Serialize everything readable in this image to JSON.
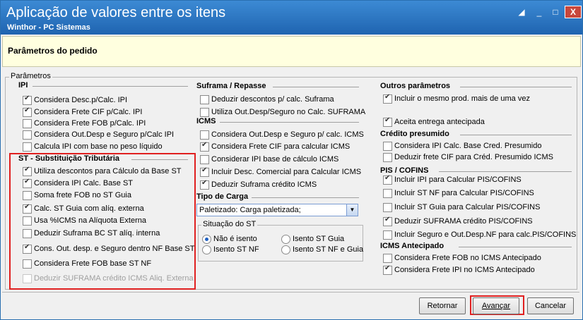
{
  "window": {
    "title": "Aplicação de valores entre os itens",
    "subtitle": "Winthor - PC Sistemas",
    "controls": [
      "◢",
      "_",
      "□",
      "X"
    ]
  },
  "header": {
    "label": "Parâmetros do pedido"
  },
  "params_legend": "Parâmetros",
  "ipi": {
    "title": "IPI",
    "items": [
      {
        "label": "Considera Desc.p/Calc. IPI",
        "checked": true
      },
      {
        "label": "Considera Frete CIF p/Calc. IPI",
        "checked": true
      },
      {
        "label": "Considera Frete FOB p/Calc. IPI",
        "checked": false
      },
      {
        "label": "Considera Out.Desp e Seguro p/Calc IPI",
        "checked": false
      },
      {
        "label": "Calcula IPI com base no peso líquido",
        "checked": false
      }
    ]
  },
  "st": {
    "title": "ST - Substituição Tributária",
    "items": [
      {
        "label": "Utiliza descontos para Cálculo da Base ST",
        "checked": true
      },
      {
        "label": "Considera IPI Calc. Base ST",
        "checked": true
      },
      {
        "label": "Soma frete FOB no ST Guia",
        "checked": false
      },
      {
        "label": "Calc. ST Guia com alíq. externa",
        "checked": true
      },
      {
        "label": "Usa %ICMS na Alíquota Externa",
        "checked": false
      },
      {
        "label": "Deduzir Suframa BC ST alíq. interna",
        "checked": false
      },
      {
        "label": "Cons. Out. desp. e Seguro dentro NF Base ST",
        "checked": true
      },
      {
        "label": "Considera Frete FOB base ST NF",
        "checked": false
      },
      {
        "label": "Deduzir SUFRAMA crédito ICMS Aliq. Externa",
        "checked": false
      }
    ]
  },
  "suframa": {
    "title": "Suframa / Repasse",
    "items": [
      {
        "label": "Deduzir descontos p/ calc. Suframa",
        "checked": false
      },
      {
        "label": "Utiliza Out.Desp/Seguro no Calc. SUFRAMA",
        "checked": false
      }
    ]
  },
  "icms": {
    "title": "ICMS",
    "items": [
      {
        "label": "Considera Out.Desp e Seguro p/ calc. ICMS",
        "checked": false
      },
      {
        "label": "Considera Frete CIF para calcular ICMS",
        "checked": true
      },
      {
        "label": "Considerar IPI base de cálculo ICMS",
        "checked": false
      },
      {
        "label": "Incluir Desc. Comercial  para Calcular ICMS",
        "checked": true
      },
      {
        "label": "Deduzir Suframa crédito ICMS",
        "checked": true
      }
    ]
  },
  "carga": {
    "title": "Tipo de Carga",
    "selected": "Paletizado: Carga paletizada;"
  },
  "situacao": {
    "legend": "Situação do ST",
    "options": [
      {
        "label": "Não é isento",
        "selected": true
      },
      {
        "label": "Isento ST Guia",
        "selected": false
      },
      {
        "label": "Isento ST NF",
        "selected": false
      },
      {
        "label": "Isento ST NF e Guia",
        "selected": false
      }
    ]
  },
  "outros": {
    "title": "Outros parâmetros",
    "items": [
      {
        "label": "Incluir o mesmo prod. mais de uma vez",
        "checked": true
      },
      {
        "label": "Aceita entrega antecipada",
        "checked": true
      }
    ]
  },
  "credito": {
    "title": "Crédito presumido",
    "items": [
      {
        "label": "Considera IPI Calc. Base Cred. Presumido",
        "checked": false
      },
      {
        "label": "Deduzir frete CIF para Créd. Presumido ICMS",
        "checked": false
      }
    ]
  },
  "pis": {
    "title": "PIS / COFINS",
    "items": [
      {
        "label": "Incluir IPI para Calcular PIS/COFINS",
        "checked": true
      },
      {
        "label": "Incluir ST NF para Calcular PIS/COFINS",
        "checked": false
      },
      {
        "label": "Incluir ST Guia para Calcular PIS/COFINS",
        "checked": false
      },
      {
        "label": "Deduzir SUFRAMA crédito PIS/COFINS",
        "checked": true
      },
      {
        "label": "Incluir Seguro e Out.Desp.NF para calc.PIS/COFINS",
        "checked": false
      }
    ]
  },
  "icms_ant": {
    "title": "ICMS Antecipado",
    "items": [
      {
        "label": "Considera Frete FOB no ICMS Antecipado",
        "checked": false
      },
      {
        "label": "Considera Frete IPI no ICMS Antecipado",
        "checked": true
      }
    ]
  },
  "buttons": {
    "retornar": "Retornar",
    "avancar": "Avançar",
    "cancelar": "Cancelar"
  },
  "colors": {
    "titlebar": "#1f64b0",
    "highlight": "#e02020",
    "header_bg": "#ffffdf"
  }
}
